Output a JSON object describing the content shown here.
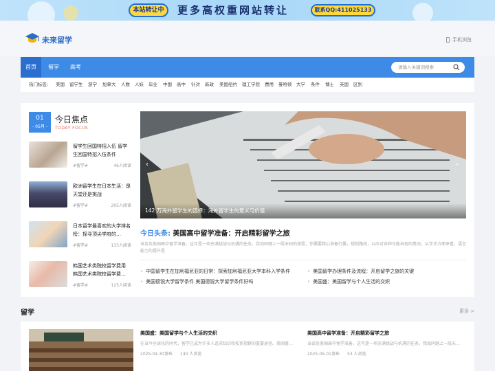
{
  "banner": {
    "sale_label": "本站转让中",
    "main_text": "更多高权重网站转让",
    "contact": "联系QQ:411025133"
  },
  "brand": {
    "name": "未来留学",
    "mobile": "手机浏览"
  },
  "nav": {
    "items": [
      "首页",
      "留学",
      "高考"
    ],
    "search_placeholder": "请输入关键词搜索"
  },
  "tags": {
    "label": "热门标签:",
    "items": [
      "美国",
      "留学生",
      "游学",
      "加拿大",
      "人数",
      "人妖",
      "毕业",
      "中国",
      "高中",
      "针对",
      "新政",
      "美国纽约",
      "理工学院",
      "费用",
      "曼哈顿",
      "大学",
      "条件",
      "博士",
      "英国",
      "区别"
    ]
  },
  "focus": {
    "day": "01",
    "month": "- 05月 -",
    "title": "今日焦点",
    "subtitle": "TODAY FOCUS",
    "items": [
      {
        "title": "留学生回国特招入伍 留学生回国特招入伍条件",
        "cat": "#留学#",
        "views": "46人阅读"
      },
      {
        "title": "欧洲留学生在日本生活：是天堂还是挑战",
        "cat": "#留学#",
        "views": "205人阅读"
      },
      {
        "title": "日本留学最喜欢的大学排名榜：探寻顶尖学府的…",
        "cat": "#留学#",
        "views": "133人阅读"
      },
      {
        "title": "韩国艺术类院校留学费用 韩国艺术类院校留学费…",
        "cat": "#留学#",
        "views": "125人阅读"
      }
    ]
  },
  "hero": {
    "caption": "142 万海外留学生的选择：海外留学生的意义与价值",
    "headline_label": "今日头条:",
    "headline": "美国高中留学准备：开启精彩留学之旅",
    "summary": "当谈及美国高中留学准备，这可是一项充满挑战与机遇的任务。我如同踏上一段未知的旅程，你需要精心准备行囊，规划路线，以应对各种可能出现的情况。从学术方面来看，语言能力的提升是",
    "links": [
      "中国留学生在加利福尼亚的日常：探索加利福尼亚大学本科入学条件",
      "美国留学办理条件及流程：开启留学之旅的关键",
      "美国德锐大学留学条件 美国德锐大学留学条件好吗",
      "美国盛：美国留学与个人生活的交织"
    ]
  },
  "section": {
    "title": "留学",
    "more": "更多 >",
    "articles": [
      {
        "title": "美国盛：美国留学与个人生活的交织",
        "desc": "在当今全球化的时代，留学已成为许多人追求知识和拓宽视野的重要途径。美国盛…",
        "date": "2025-04-30发布",
        "views": "140 人浏览"
      },
      {
        "title": "美国高中留学准备：开启精彩留学之旅",
        "desc": "当谈及美国高中留学准备，这可是一项充满挑战与机遇的任务。我如同踏上一段未…",
        "date": "2025-05-01发布",
        "views": "53 人浏览"
      }
    ]
  }
}
